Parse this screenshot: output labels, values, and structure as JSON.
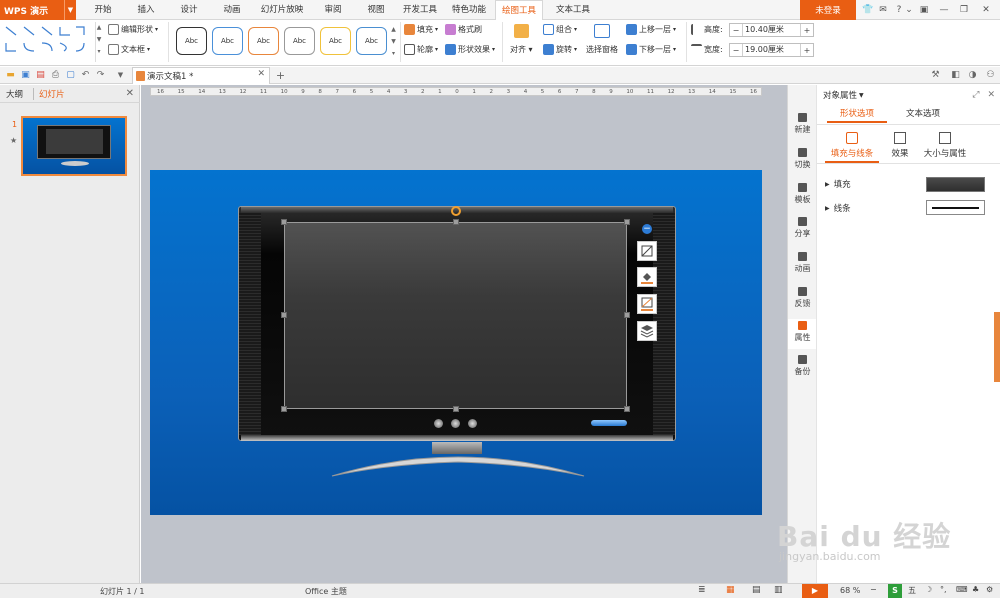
{
  "app": {
    "menu": "WPS 演示",
    "login": "未登录"
  },
  "tabs": [
    "开始",
    "插入",
    "设计",
    "动画",
    "幻灯片放映",
    "审阅",
    "视图",
    "开发工具",
    "特色功能",
    "绘图工具",
    "文本工具"
  ],
  "ribbon": {
    "edit_shape": "编辑形状",
    "textbox": "文本框",
    "style_presets": [
      "Abc",
      "Abc",
      "Abc",
      "Abc",
      "Abc",
      "Abc"
    ],
    "style_colors": [
      "#333333",
      "#4a90d9",
      "#e8863c",
      "#999999",
      "#f0c23b",
      "#4a8fd1"
    ],
    "fill": "填充",
    "outline": "轮廓",
    "format_painter": "格式刷",
    "shape_effects": "形状效果",
    "align": "对齐",
    "group": "组合",
    "rotate": "旋转",
    "selection_pane": "选择窗格",
    "bring_forward": "上移一层",
    "send_backward": "下移一层",
    "height_label": "高度:",
    "height_value": "10.40厘米",
    "width_label": "宽度:",
    "width_value": "19.00厘米"
  },
  "document": {
    "tab_title": "演示文稿1 *"
  },
  "left_pane": {
    "tab_outline": "大纲",
    "tab_slides": "幻灯片",
    "slide_number": "1",
    "slide_marker": "★"
  },
  "ruler": {
    "labels": [
      "16",
      "15",
      "14",
      "13",
      "12",
      "11",
      "10",
      "9",
      "8",
      "7",
      "6",
      "5",
      "4",
      "3",
      "2",
      "1",
      "0",
      "1",
      "2",
      "3",
      "4",
      "5",
      "6",
      "7",
      "8",
      "9",
      "10",
      "11",
      "12",
      "13",
      "14",
      "15",
      "16"
    ]
  },
  "sidebar": [
    {
      "label": "新建",
      "icon": "new-icon"
    },
    {
      "label": "切换",
      "icon": "transition-icon"
    },
    {
      "label": "模板",
      "icon": "template-icon"
    },
    {
      "label": "分享",
      "icon": "share-icon"
    },
    {
      "label": "动画",
      "icon": "animation-icon"
    },
    {
      "label": "反馈",
      "icon": "feedback-icon"
    },
    {
      "label": "属性",
      "icon": "properties-icon"
    },
    {
      "label": "备份",
      "icon": "backup-icon"
    }
  ],
  "properties": {
    "title": "对象属性",
    "tab_shape": "形状选项",
    "tab_text": "文本选项",
    "sub_fill_line": "填充与线条",
    "sub_effects": "效果",
    "sub_size": "大小与属性",
    "fill_label": "填充",
    "line_label": "线条"
  },
  "status": {
    "slide": "幻灯片 1 / 1",
    "theme": "Office 主题",
    "zoom": "68 %"
  },
  "watermark": {
    "logo": "Bai du 经验",
    "url": "jingyan.baidu.com"
  },
  "colors": {
    "accent": "#e95e13",
    "slide_bg": "#0b66c2",
    "selected_outline": "#f0a030"
  }
}
